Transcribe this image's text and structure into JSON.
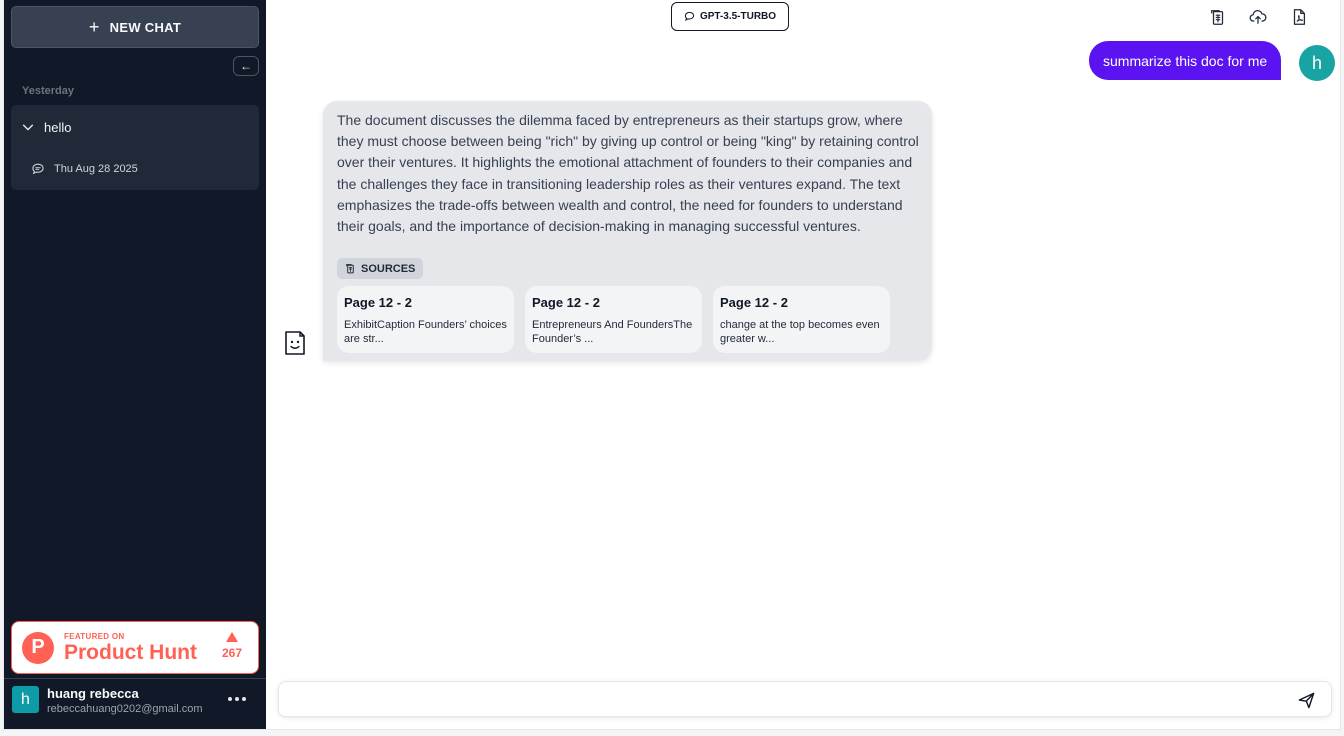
{
  "sidebar": {
    "new_chat_label": "NEW CHAT",
    "collapse_arrow": "←",
    "section_label": "Yesterday",
    "chat_group": {
      "title": "hello",
      "date": "Thu Aug 28 2025"
    },
    "product_hunt": {
      "featured": "FEATURED ON",
      "name": "Product Hunt",
      "logo_letter": "P",
      "votes": "267"
    },
    "user": {
      "initial": "h",
      "name": "huang rebecca",
      "email": "rebeccahuang0202@gmail.com"
    }
  },
  "header": {
    "model": "GPT-3.5-TURBO",
    "icons": [
      "document-stack-icon",
      "cloud-upload-icon",
      "pdf-file-icon"
    ]
  },
  "messages": {
    "user": {
      "text": "summarize this doc for me",
      "avatar": "h"
    },
    "bot": {
      "text": "The document discusses the dilemma faced by entrepreneurs as their startups grow, where they must choose between being \"rich\" by giving up control or being \"king\" by retaining control over their ventures. It highlights the emotional attachment of founders to their companies and the challenges they face in transitioning leadership roles as their ventures expand. The text emphasizes the trade-offs between wealth and control, the need for founders to understand their goals, and the importance of decision-making in managing successful ventures.",
      "sources_label": "SOURCES",
      "sources": [
        {
          "title": "Page 12 - 2",
          "snippet": "ExhibitCaption Founders’ choices are str..."
        },
        {
          "title": "Page 12 - 2",
          "snippet": "Entrepreneurs And FoundersThe Founder’s ..."
        },
        {
          "title": "Page 12 - 2",
          "snippet": "change at the top becomes even greater w..."
        }
      ]
    }
  },
  "composer": {
    "placeholder": ""
  },
  "colors": {
    "sidebar_bg": "#111827",
    "user_bubble": "#5b13f2",
    "bot_bubble": "#e5e7eb",
    "product_hunt": "#ff6154",
    "avatar_teal": "#1aa3a3"
  }
}
